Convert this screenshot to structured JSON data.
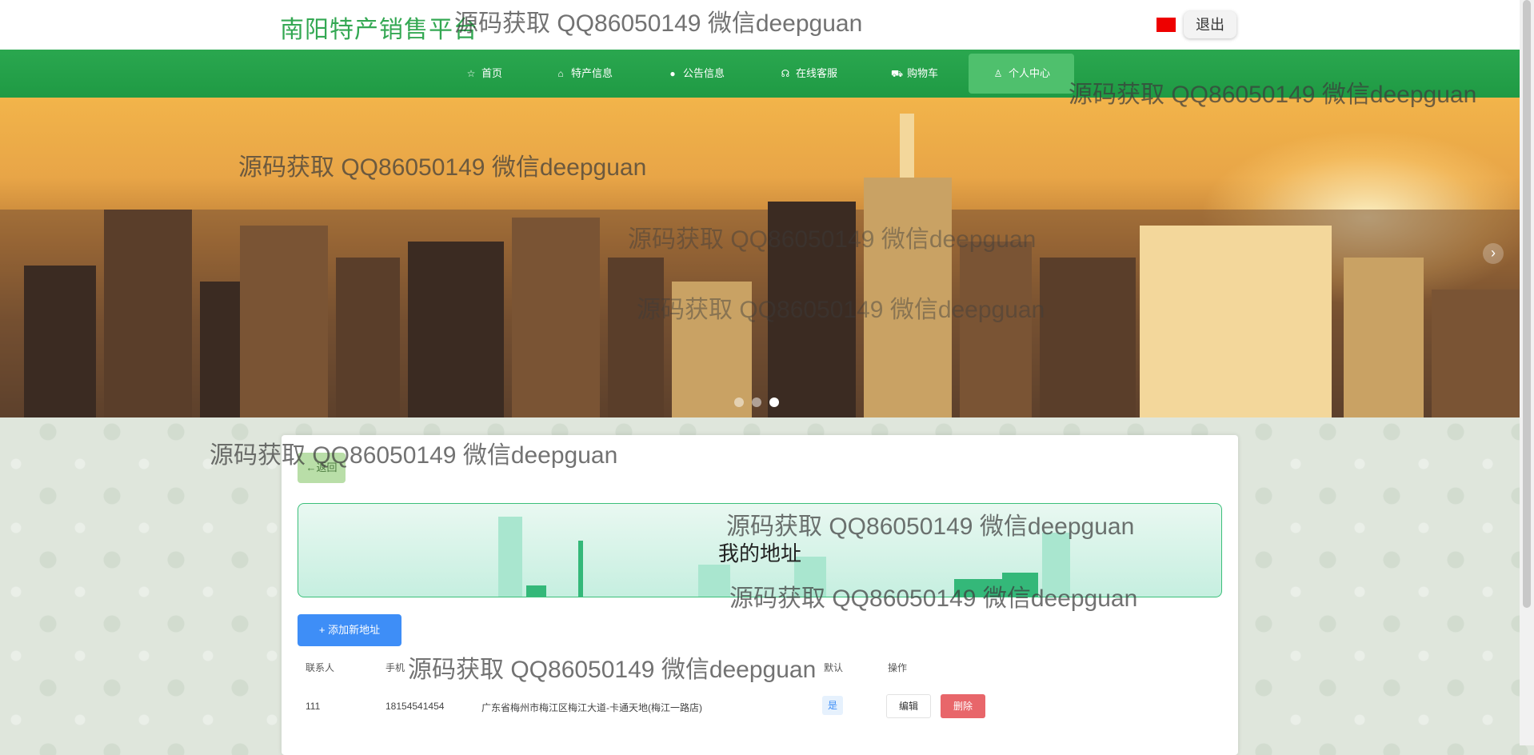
{
  "header": {
    "site_title": "南阳特产销售平台",
    "logout_label": "退出"
  },
  "nav": {
    "items": [
      {
        "label": "首页",
        "icon": "star-icon",
        "glyph": "☆"
      },
      {
        "label": "特产信息",
        "icon": "bag-icon",
        "glyph": "⌂"
      },
      {
        "label": "公告信息",
        "icon": "info-icon",
        "glyph": "●"
      },
      {
        "label": "在线客服",
        "icon": "headset-icon",
        "glyph": "☊"
      },
      {
        "label": "购物车",
        "icon": "cart-icon",
        "glyph": "⛟"
      },
      {
        "label": "个人中心",
        "icon": "user-icon",
        "glyph": "♙",
        "active": true
      }
    ]
  },
  "banner": {
    "slides": 3,
    "active_slide": 3,
    "next_arrow": "›"
  },
  "main": {
    "back_label": "←返回",
    "page_title": "我的地址",
    "add_button_label": "+ 添加新地址",
    "table": {
      "columns": [
        "联系人",
        "手机",
        "",
        "默认",
        "操作"
      ],
      "rows": [
        {
          "contact": "111",
          "phone": "18154541454",
          "address": "广东省梅州市梅江区梅江大道-卡通天地(梅江一路店)",
          "is_default": "是",
          "edit_label": "编辑",
          "delete_label": "删除"
        }
      ]
    }
  },
  "watermark": "源码获取 QQ86050149 微信deepguan",
  "colors": {
    "brand_green": "#2aa74f",
    "primary_blue": "#3e8ef7",
    "danger_red": "#e8666a"
  }
}
